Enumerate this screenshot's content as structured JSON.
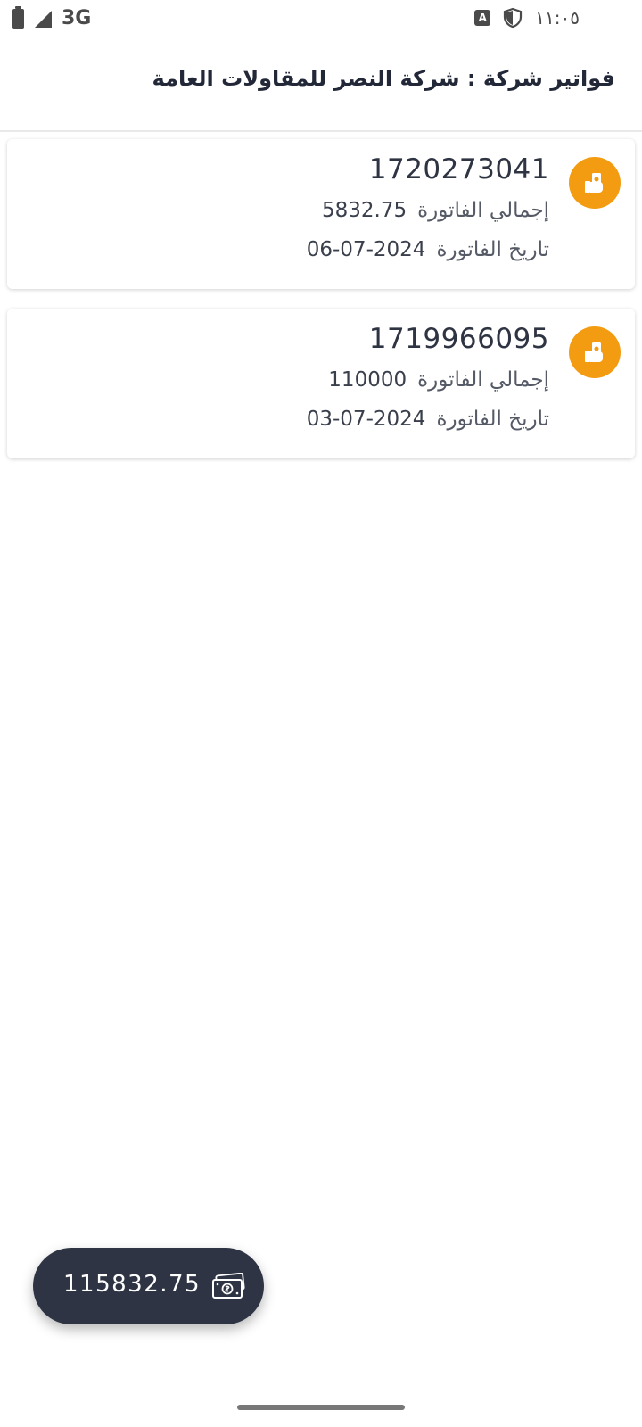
{
  "status_bar": {
    "network": "3G",
    "time": "١١:٠٥",
    "keyboard_badge": "A"
  },
  "header": {
    "title": "فواتير شركة : شركة النصر للمقاولات العامة"
  },
  "invoices": [
    {
      "number": "1720273041",
      "total_label": "إجمالي الفاتورة",
      "total_value": "5832.75",
      "date_label": "تاريخ الفاتورة",
      "date_value": "2024-07-06"
    },
    {
      "number": "1719966095",
      "total_label": "إجمالي الفاتورة",
      "total_value": "110000",
      "date_label": "تاريخ الفاتورة",
      "date_value": "2024-07-03"
    }
  ],
  "summary": {
    "grand_total": "115832.75"
  },
  "icons": {
    "invoice_avatar": "hand-money-icon",
    "total": "money-icon"
  },
  "colors": {
    "accent": "#f39c12",
    "pill": "#2e3444",
    "title": "#232838"
  }
}
